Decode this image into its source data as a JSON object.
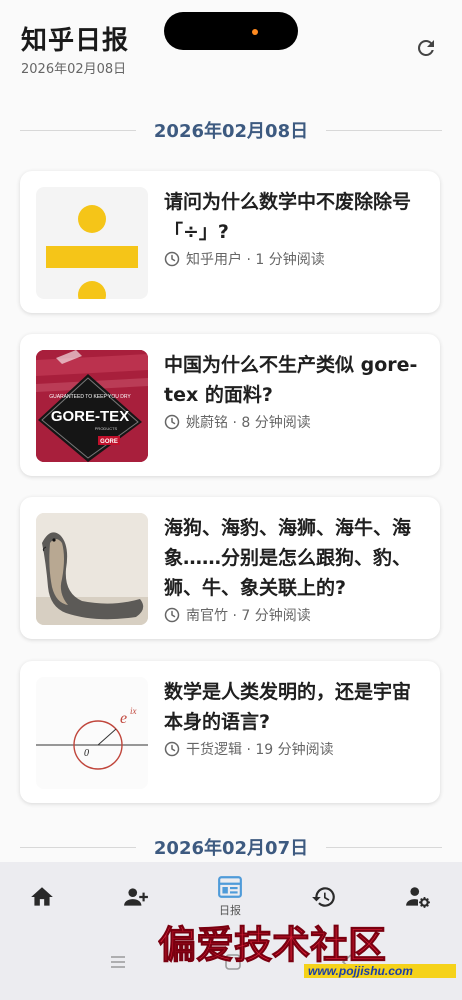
{
  "header": {
    "title": "知乎日报",
    "date": "2026年02月08日"
  },
  "sections": [
    {
      "date": "2026年02月08日"
    },
    {
      "date": "2026年02月07日"
    }
  ],
  "stories": [
    {
      "title": "请问为什么数学中不废除除号「÷」?",
      "meta": "知乎用户 · 1 分钟阅读"
    },
    {
      "title": "中国为什么不生产类似 gore-tex 的面料?",
      "meta": "姚蔚铭 · 8 分钟阅读"
    },
    {
      "title": "海狗、海豹、海狮、海牛、海象……分别是怎么跟狗、豹、狮、牛、象关联上的?",
      "meta": "南官竹 · 7 分钟阅读"
    },
    {
      "title": "数学是人类发明的，还是宇宙本身的语言?",
      "meta": "干货逻辑 · 19 分钟阅读"
    }
  ],
  "thumbs": {
    "gore_small": "GUARANTEED TO KEEP YOU DRY",
    "gore_big": "GORE-TEX",
    "gore_sub": "PRODUCTS",
    "gore_logo": "GORE",
    "math_exp": "e",
    "math_sup": "ix",
    "math_origin": "0"
  },
  "nav": {
    "items": [
      {
        "icon": "home-icon"
      },
      {
        "icon": "add-person-icon"
      },
      {
        "icon": "daily-icon",
        "label": "日报",
        "active": true
      },
      {
        "icon": "history-icon"
      },
      {
        "icon": "user-settings-icon"
      }
    ]
  },
  "watermark": {
    "brand": "偏爱技术社区",
    "url": "www.pojjishu.com"
  },
  "colors": {
    "accent": "#3d5a80",
    "active_nav": "#4f9bd9",
    "divide_yellow": "#f5c518"
  }
}
